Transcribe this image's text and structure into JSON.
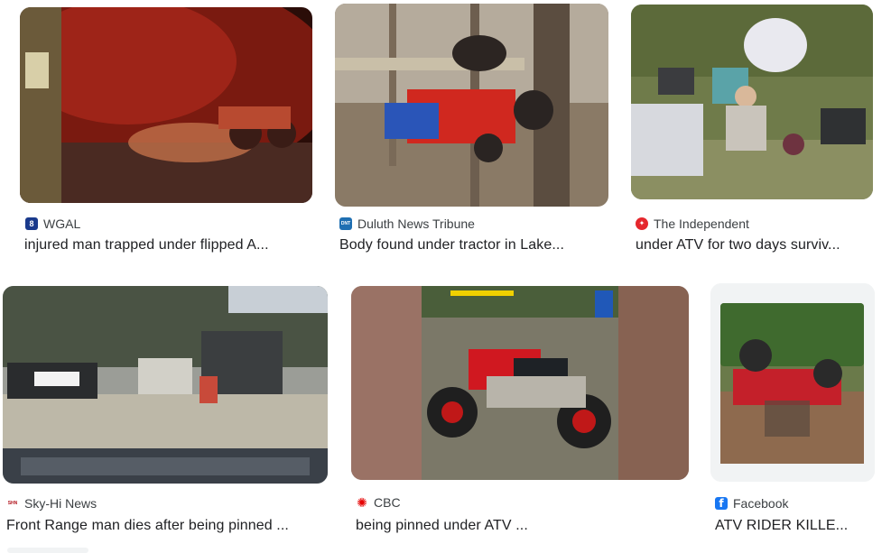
{
  "results": [
    {
      "source": "WGAL",
      "title": "injured man trapped under flipped A...",
      "icon": "wgal-8-logo-icon",
      "icon_color": "#1a3a8c",
      "icon_text": "8"
    },
    {
      "source": "Duluth News Tribune",
      "title": "Body found under tractor in Lake...",
      "icon": "dnt-logo-icon",
      "icon_color": "#1f6fb2",
      "icon_text": "DNT"
    },
    {
      "source": "The Independent",
      "title": "under ATV for two days surviv...",
      "icon": "independent-eagle-icon",
      "icon_color": "#e5272d",
      "icon_text": "✦"
    },
    {
      "source": "Sky-Hi News",
      "title": "Front Range man dies after being pinned ...",
      "icon": "sky-hi-news-logo-icon",
      "icon_color": "#b1121b",
      "icon_text": "SHN"
    },
    {
      "source": "CBC",
      "title": "being pinned under ATV ...",
      "icon": "cbc-gem-icon",
      "icon_color": "#e60505",
      "icon_text": "✺"
    },
    {
      "source": "Facebook",
      "title": "ATV RIDER KILLE...",
      "icon": "facebook-icon",
      "icon_color": "#1877f2",
      "icon_text": "f"
    }
  ]
}
